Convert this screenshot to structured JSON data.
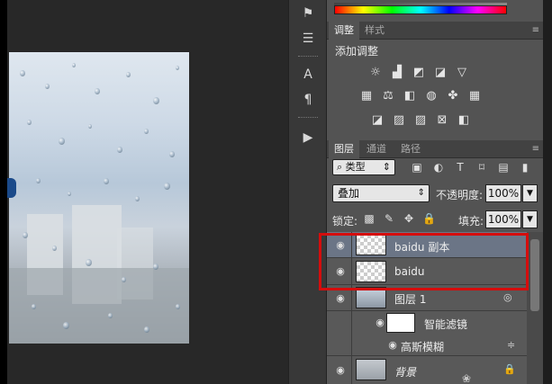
{
  "colors": {
    "highlight": "#d50d0d",
    "panel_bg": "#535353",
    "selected_row": "#6b7586"
  },
  "toolstrip": {
    "tools": [
      "brush-icon",
      "sliders-icon",
      "character-icon",
      "paragraph-icon",
      "play-icon"
    ]
  },
  "adjustments_panel": {
    "tabs": [
      "调整",
      "样式"
    ],
    "title": "添加调整",
    "icons_row1": [
      "brightness-icon",
      "levels-icon",
      "curves-icon",
      "exposure-icon",
      "vibrance-icon"
    ],
    "icons_row2": [
      "hue-saturation-icon",
      "color-balance-icon",
      "black-white-icon",
      "photo-filter-icon",
      "channel-mixer-icon",
      "color-lookup-icon"
    ],
    "icons_row3": [
      "invert-icon",
      "posterize-icon",
      "threshold-icon",
      "selective-color-icon",
      "gradient-map-icon"
    ]
  },
  "layers_panel": {
    "tabs": [
      "图层",
      "通道",
      "路径"
    ],
    "filter_label": "类型",
    "blend_mode": "叠加",
    "opacity_label": "不透明度:",
    "opacity_value": "100%",
    "lock_label": "锁定:",
    "fill_label": "填充:",
    "fill_value": "100%",
    "layers": [
      {
        "name": "baidu 副本",
        "selected": true
      },
      {
        "name": "baidu",
        "selected": false
      },
      {
        "name": "图层 1",
        "selected": false
      },
      {
        "name": "智能滤镜",
        "selected": false
      },
      {
        "name": "高斯模糊",
        "selected": false
      },
      {
        "name": "背景",
        "selected": false
      }
    ]
  }
}
